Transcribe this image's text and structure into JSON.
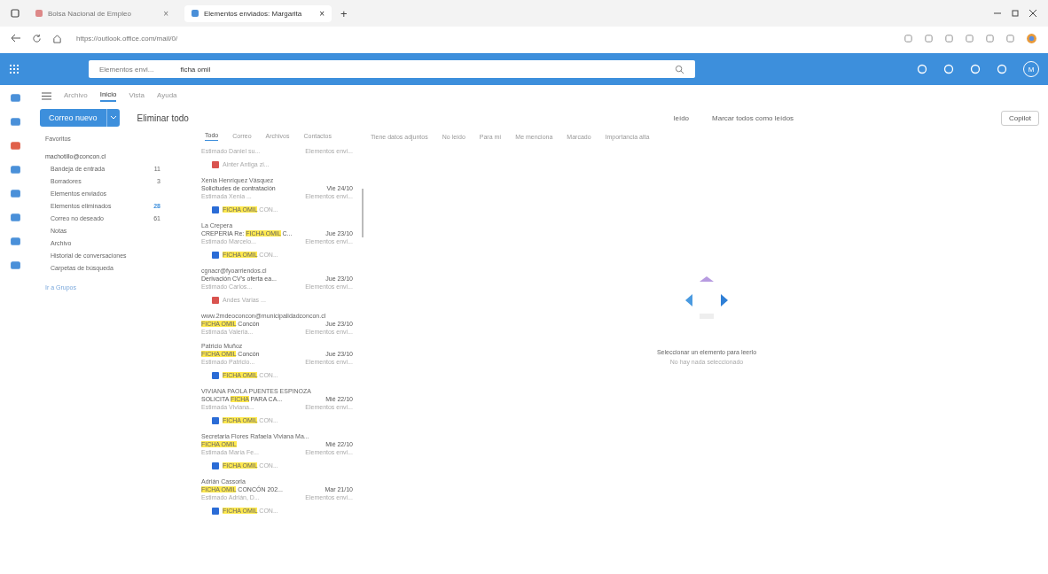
{
  "browser": {
    "tabs": [
      {
        "title": "Bolsa Nacional de Empleo",
        "close": "×",
        "selected": false
      },
      {
        "title": "Elementos enviados: Margarita",
        "close": "×",
        "selected": true
      }
    ],
    "new_tab": "+",
    "url": "https://outlook.office.com/mail/0/"
  },
  "header": {
    "search_scope": "Elementos envi...",
    "search_query": "ficha omil",
    "avatar": "M"
  },
  "ribbon_tabs": [
    {
      "label": "Archivo",
      "selected": false
    },
    {
      "label": "Inicio",
      "selected": true
    },
    {
      "label": "Vista",
      "selected": false
    },
    {
      "label": "Ayuda",
      "selected": false
    }
  ],
  "toolbar": {
    "new_mail": "Correo nuevo",
    "delete_all": "Eliminar todo",
    "read": "leído",
    "mark_all_read": "Marcar todos como leídos",
    "copilot": "Copilot"
  },
  "folders": {
    "favorites": "Favoritos",
    "account": "machotillo@concon.cl",
    "items": [
      {
        "name": "Bandeja de entrada",
        "count": "11",
        "selected": false,
        "unread_style": false
      },
      {
        "name": "Borradores",
        "count": "3",
        "selected": false,
        "unread_style": false
      },
      {
        "name": "Elementos enviados",
        "selected": false
      },
      {
        "name": "Elementos eliminados",
        "count": "28",
        "selected": false,
        "unread_style": true
      },
      {
        "name": "Correo no deseado",
        "count": "61",
        "selected": false,
        "unread_style": false
      },
      {
        "name": "Notas",
        "selected": false
      },
      {
        "name": "Archivo",
        "selected": false
      },
      {
        "name": "Historial de conversaciones",
        "selected": false
      },
      {
        "name": "Carpetas de búsqueda",
        "selected": false
      }
    ],
    "groups_link": "Ir a Grupos"
  },
  "result_tabs": [
    {
      "label": "Todo",
      "selected": true
    },
    {
      "label": "Correo",
      "selected": false
    },
    {
      "label": "Archivos",
      "selected": false
    },
    {
      "label": "Contactos",
      "selected": false
    }
  ],
  "filters": [
    "Tiene datos adjuntos",
    "No leído",
    "Para mí",
    "Me menciona",
    "Marcado",
    "Importancia alta"
  ],
  "messages": [
    {
      "preview": "Estimado Daniel su...",
      "folder": "Elementos envi...",
      "attachment": {
        "kind": "pdf",
        "name": [
          {
            "text": "Ainter Antiga zi...",
            "highlight": false
          }
        ]
      }
    },
    {
      "sender": "Xenia Henríquez Vásquez",
      "subject": [
        {
          "text": "Solicitudes de contratación",
          "highlight": false
        }
      ],
      "date": "Vie 24/10",
      "preview": "Estimada Xenia ...",
      "folder": "Elementos envi...",
      "attachment": {
        "kind": "doc",
        "name": [
          {
            "text": "FICHA OMIL",
            "highlight": true
          },
          {
            "text": " CON...",
            "highlight": false
          }
        ]
      }
    },
    {
      "sender": "La Crepera",
      "subject": [
        {
          "text": "CREPERIA Re: ",
          "highlight": false
        },
        {
          "text": "FICHA OMIL",
          "highlight": true
        },
        {
          "text": " C...",
          "highlight": false
        }
      ],
      "date": "Jue 23/10",
      "preview": "Estimado Marcelo...",
      "folder": "Elementos envi...",
      "attachment": {
        "kind": "doc",
        "name": [
          {
            "text": "FICHA OMIL",
            "highlight": true
          },
          {
            "text": " CON...",
            "highlight": false
          }
        ]
      }
    },
    {
      "sender": "cgnacr@fyoarriendos.cl",
      "subject": [
        {
          "text": "Derivación CV's oferta ea...",
          "highlight": false
        }
      ],
      "date": "Jue 23/10",
      "preview": "Estimado Carlos...",
      "folder": "Elementos envi...",
      "attachment": {
        "kind": "pdf",
        "name": [
          {
            "text": "Andes Varias ...",
            "highlight": false
          }
        ]
      }
    },
    {
      "sender": "www.2mdeoconcon@municipalidadconcon.cl",
      "subject": [
        {
          "text": "FICHA OMIL",
          "highlight": true
        },
        {
          "text": " Concón",
          "highlight": false
        }
      ],
      "date": "Jue 23/10",
      "preview": "Estimada Valeria...",
      "folder": "Elementos envi..."
    },
    {
      "sender": "Patricio Muñoz",
      "subject": [
        {
          "text": "FICHA OMIL",
          "highlight": true
        },
        {
          "text": " Concón",
          "highlight": false
        }
      ],
      "date": "Jue 23/10",
      "preview": "Estimado Patricio...",
      "folder": "Elementos envi...",
      "attachment": {
        "kind": "doc",
        "name": [
          {
            "text": "FICHA OMIL",
            "highlight": true
          },
          {
            "text": " CON...",
            "highlight": false
          }
        ]
      }
    },
    {
      "sender": "VIVIANA PAOLA PUENTES ESPINOZA",
      "subject": [
        {
          "text": "SOLICITA ",
          "highlight": false
        },
        {
          "text": "FICHA",
          "highlight": true
        },
        {
          "text": " PARA CA...",
          "highlight": false
        }
      ],
      "date": "Mié 22/10",
      "preview": "Estimada Viviana...",
      "folder": "Elementos envi...",
      "attachment": {
        "kind": "doc",
        "name": [
          {
            "text": "FICHA OMIL",
            "highlight": true
          },
          {
            "text": " CON...",
            "highlight": false
          }
        ]
      }
    },
    {
      "sender": "Secretaria Flores Rafaela Viviana Ma...",
      "subject": [
        {
          "text": "FICHA OMIL",
          "highlight": true
        }
      ],
      "date": "Mié 22/10",
      "preview": "Estimada María Fe...",
      "folder": "Elementos envi...",
      "attachment": {
        "kind": "doc",
        "name": [
          {
            "text": "FICHA OMIL",
            "highlight": true
          },
          {
            "text": " CON...",
            "highlight": false
          }
        ]
      }
    },
    {
      "sender": "Adrián Cassorla",
      "subject": [
        {
          "text": "FICHA OMIL",
          "highlight": true
        },
        {
          "text": " CONCÓN 202...",
          "highlight": false
        }
      ],
      "date": "Mar 21/10",
      "preview": "Estimado Adrián, D...",
      "folder": "Elementos envi...",
      "attachment": {
        "kind": "doc",
        "name": [
          {
            "text": "FICHA OMIL",
            "highlight": true
          },
          {
            "text": " CON...",
            "highlight": false
          }
        ]
      }
    }
  ],
  "reading_pane": {
    "title": "Seleccionar un elemento para leerlo",
    "subtitle": "No hay nada seleccionado"
  }
}
